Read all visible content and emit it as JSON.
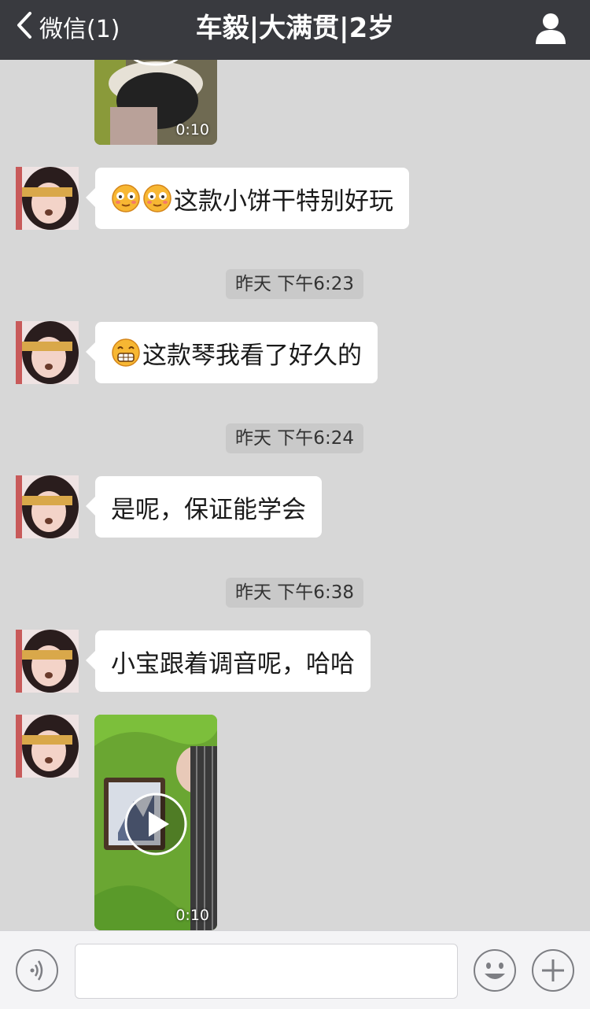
{
  "header": {
    "back_label": "微信(1)",
    "title": "车毅|大满贯|2岁"
  },
  "messages": [
    {
      "kind": "video",
      "duration": "0:10"
    },
    {
      "kind": "text",
      "emojis": [
        "blush-emoji",
        "blush-emoji"
      ],
      "text": "这款小饼干特别好玩"
    },
    {
      "kind": "time",
      "text": "昨天 下午6:23"
    },
    {
      "kind": "text",
      "emojis": [
        "grin-emoji"
      ],
      "text": "这款琴我看了好久的"
    },
    {
      "kind": "time",
      "text": "昨天 下午6:24"
    },
    {
      "kind": "text",
      "text": "是呢，保证能学会"
    },
    {
      "kind": "time",
      "text": "昨天 下午6:38"
    },
    {
      "kind": "text",
      "text": "小宝跟着调音呢，哈哈"
    },
    {
      "kind": "video",
      "duration": "0:10"
    }
  ],
  "toolbar": {
    "voice_icon": "voice-icon",
    "emoji_icon": "emoji-icon",
    "more_icon": "plus-icon",
    "input_value": ""
  },
  "colors": {
    "navbar": "#393a3f",
    "chat_background": "#d7d7d7",
    "bubble": "#ffffff",
    "time_pill": "#c9c9c9"
  }
}
